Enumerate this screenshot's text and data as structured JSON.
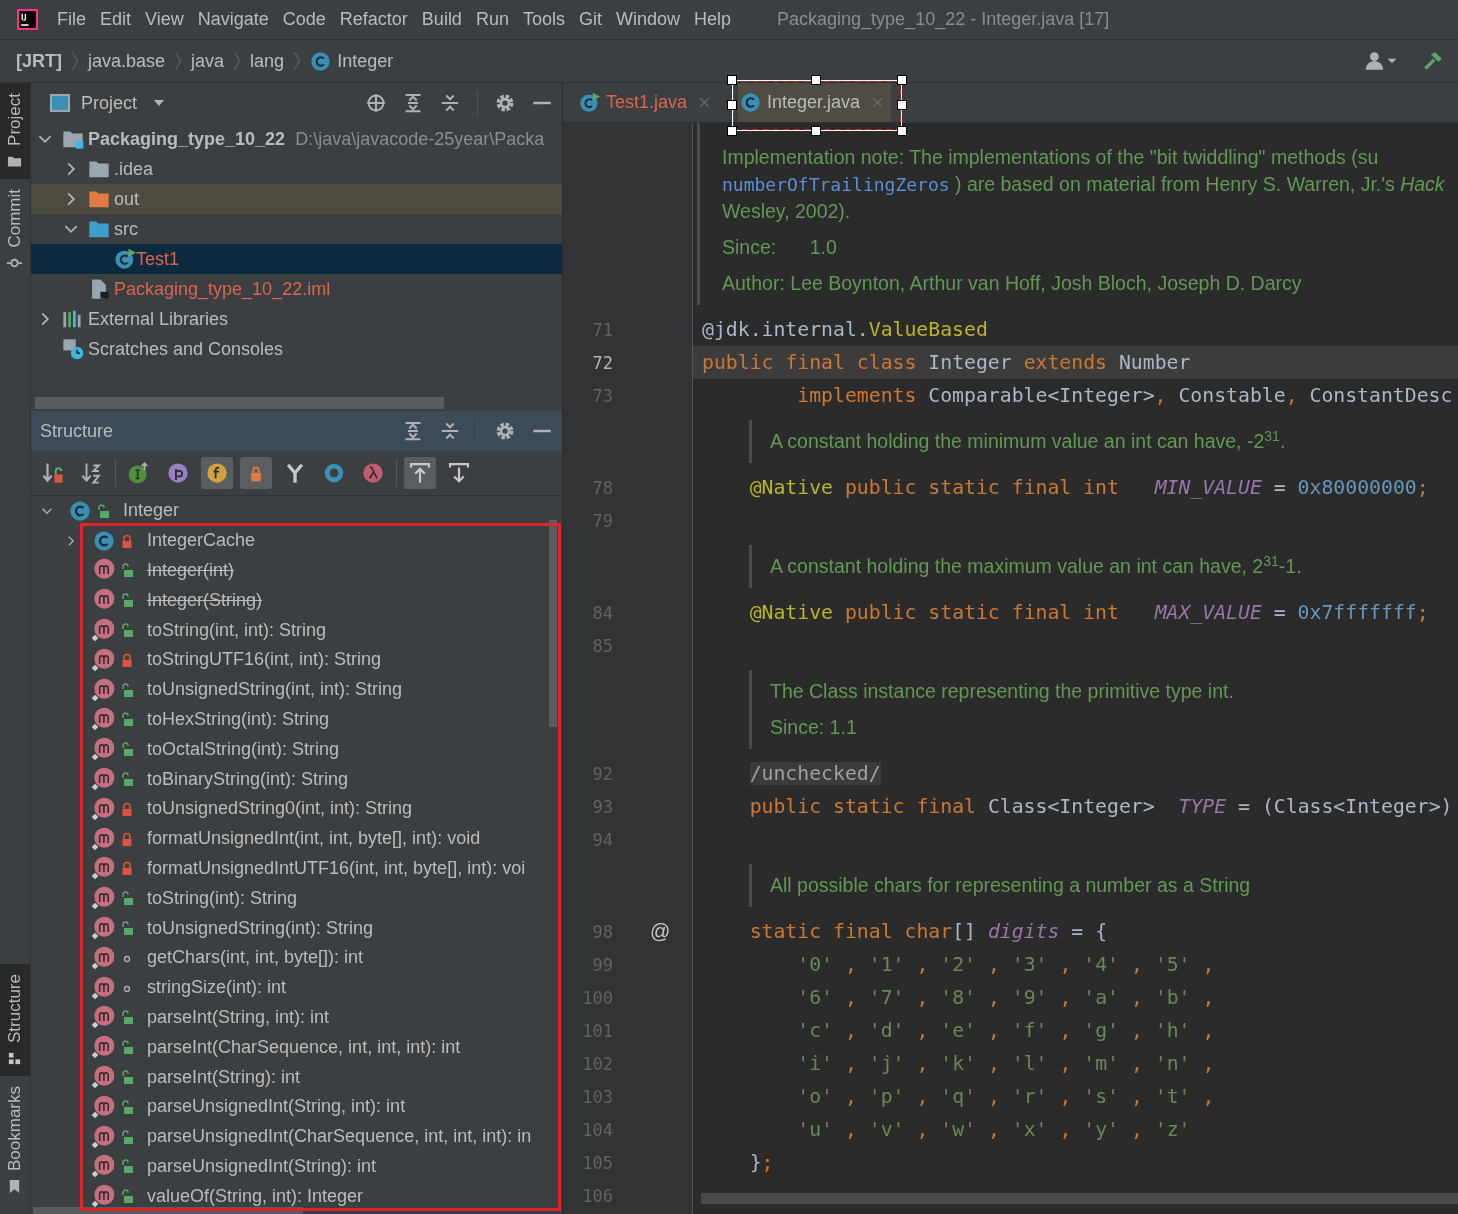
{
  "window": {
    "title": "Packaging_type_10_22 - Integer.java [17]"
  },
  "menu": [
    "File",
    "Edit",
    "View",
    "Navigate",
    "Code",
    "Refactor",
    "Build",
    "Run",
    "Tools",
    "Git",
    "Window",
    "Help"
  ],
  "breadcrumb": [
    {
      "label": "[JRT]",
      "kind": "root"
    },
    {
      "label": "java.base",
      "kind": "plain"
    },
    {
      "label": "java",
      "kind": "plain"
    },
    {
      "label": "lang",
      "kind": "plain"
    },
    {
      "label": "Integer",
      "kind": "class"
    }
  ],
  "tool_stripe": {
    "top": [
      {
        "label": "Project",
        "kind": "project",
        "selected": true
      },
      {
        "label": "Commit",
        "kind": "commit",
        "selected": false
      }
    ],
    "bottom": [
      {
        "label": "Structure",
        "kind": "structure",
        "selected": true
      },
      {
        "label": "Bookmarks",
        "kind": "bookmarks",
        "selected": false
      }
    ]
  },
  "project_panel": {
    "title": "Project",
    "tree": [
      {
        "label": "Packaging_type_10_22",
        "path": "D:\\java\\javacode-25year\\Packa",
        "kind": "module",
        "expanded": true,
        "selected": false,
        "untracked": false,
        "children": [
          {
            "label": ".idea",
            "kind": "folder",
            "expanded": false,
            "selected": false,
            "untracked": false
          },
          {
            "label": "out",
            "kind": "excluded-folder",
            "expanded": false,
            "selected": false,
            "untracked": false
          },
          {
            "label": "src",
            "kind": "source-folder",
            "expanded": true,
            "selected": false,
            "untracked": false,
            "children": [
              {
                "label": "Test1",
                "kind": "runnable-class",
                "selected": true,
                "untracked": true
              }
            ]
          },
          {
            "label": "Packaging_type_10_22.iml",
            "kind": "module-file",
            "selected": false,
            "untracked": true
          }
        ]
      },
      {
        "label": "External Libraries",
        "kind": "libraries",
        "expanded": false,
        "selected": false,
        "untracked": false
      },
      {
        "label": "Scratches and Consoles",
        "kind": "scratches",
        "selected": false,
        "untracked": false
      }
    ]
  },
  "structure_panel": {
    "title": "Structure",
    "toolbar": [
      [
        {
          "kind": "sort-visibility",
          "on": false
        },
        {
          "kind": "sort-alpha",
          "on": false
        }
      ],
      [
        {
          "kind": "inherited",
          "on": false
        },
        {
          "kind": "properties",
          "on": false
        },
        {
          "kind": "fields",
          "on": true
        },
        {
          "kind": "non-public",
          "on": true
        },
        {
          "kind": "fork",
          "on": false
        },
        {
          "kind": "ring",
          "on": false
        },
        {
          "kind": "lambda",
          "on": false
        }
      ],
      [
        {
          "kind": "autoscroll-to",
          "on": true
        },
        {
          "kind": "autoscroll-from",
          "on": false
        }
      ]
    ],
    "tree": [
      {
        "label": "Integer",
        "kind": "public-class",
        "expanded": true,
        "deprecated": false,
        "children": [
          {
            "label": "IntegerCache",
            "kind": "private-class",
            "expanded": false,
            "deprecated": false
          },
          {
            "label": "Integer(int)",
            "kind": "public-method",
            "deprecated": true,
            "static": false
          },
          {
            "label": "Integer(String)",
            "kind": "public-method",
            "deprecated": true,
            "static": false
          },
          {
            "label": "toString(int, int): String",
            "kind": "public-method",
            "deprecated": false,
            "static": true
          },
          {
            "label": "toStringUTF16(int, int): String",
            "kind": "private-method",
            "deprecated": false,
            "static": true
          },
          {
            "label": "toUnsignedString(int, int): String",
            "kind": "public-method",
            "deprecated": false,
            "static": true
          },
          {
            "label": "toHexString(int): String",
            "kind": "public-method",
            "deprecated": false,
            "static": true
          },
          {
            "label": "toOctalString(int): String",
            "kind": "public-method",
            "deprecated": false,
            "static": true
          },
          {
            "label": "toBinaryString(int): String",
            "kind": "public-method",
            "deprecated": false,
            "static": true
          },
          {
            "label": "toUnsignedString0(int, int): String",
            "kind": "private-method",
            "deprecated": false,
            "static": true
          },
          {
            "label": "formatUnsignedInt(int, int, byte[], int): void",
            "kind": "private-method",
            "deprecated": false,
            "static": true
          },
          {
            "label": "formatUnsignedIntUTF16(int, int, byte[], int): voi",
            "kind": "private-method",
            "deprecated": false,
            "static": true
          },
          {
            "label": "toString(int): String",
            "kind": "public-method",
            "deprecated": false,
            "static": true
          },
          {
            "label": "toUnsignedString(int): String",
            "kind": "public-method",
            "deprecated": false,
            "static": true
          },
          {
            "label": "getChars(int, int, byte[]): int",
            "kind": "package-method",
            "deprecated": false,
            "static": true
          },
          {
            "label": "stringSize(int): int",
            "kind": "package-method",
            "deprecated": false,
            "static": true
          },
          {
            "label": "parseInt(String, int): int",
            "kind": "public-method",
            "deprecated": false,
            "static": true
          },
          {
            "label": "parseInt(CharSequence, int, int, int): int",
            "kind": "public-method",
            "deprecated": false,
            "static": true
          },
          {
            "label": "parseInt(String): int",
            "kind": "public-method",
            "deprecated": false,
            "static": true
          },
          {
            "label": "parseUnsignedInt(String, int): int",
            "kind": "public-method",
            "deprecated": false,
            "static": true
          },
          {
            "label": "parseUnsignedInt(CharSequence, int, int, int): in",
            "kind": "public-method",
            "deprecated": false,
            "static": true
          },
          {
            "label": "parseUnsignedInt(String): int",
            "kind": "public-method",
            "deprecated": false,
            "static": true
          },
          {
            "label": "valueOf(String, int): Integer",
            "kind": "public-method",
            "deprecated": false,
            "static": true
          }
        ]
      }
    ]
  },
  "editor": {
    "tabs": [
      {
        "label": "Test1.java",
        "kind": "runnable-class",
        "selected": false,
        "untracked": true
      },
      {
        "label": "Integer.java",
        "kind": "class",
        "selected": true,
        "untracked": false
      }
    ],
    "lines": [
      {
        "kind": "doc",
        "inside_class": false,
        "paragraphs": [
          [
            {
              "text": "Implementation note: The implementations of the \"bit twiddling\" methods (su"
            },
            {
              "link": "numberOfTrailingZeros",
              "text": ") are based on material from Henry S. Warren, Jr.'s *Hack*"
            },
            {
              "text": "Wesley, 2002)."
            }
          ],
          [
            {
              "label": "Since:",
              "text": "1.0"
            }
          ],
          [
            {
              "text": "Author: Lee Boynton, Arthur van Hoff, Josh Bloch, Joseph D. Darcy"
            }
          ]
        ]
      },
      {
        "kind": "code",
        "number": "71",
        "current": false,
        "text": "@jdk.internal.ValueBased"
      },
      {
        "kind": "code",
        "number": "72",
        "current": true,
        "text": "public final class Integer extends Number"
      },
      {
        "kind": "code",
        "number": "73",
        "current": false,
        "text": "        implements Comparable<Integer>, Constable, ConstantDesc"
      },
      {
        "kind": "doc",
        "inside_class": true,
        "paragraphs": [
          [
            {
              "text": "A constant holding the minimum value an int can have, -2$^{31}$."
            }
          ]
        ]
      },
      {
        "kind": "code",
        "number": "78",
        "current": false,
        "text": "    @Native public static final int   MIN_VALUE = 0x80000000;"
      },
      {
        "kind": "code",
        "number": "79",
        "current": false
      },
      {
        "kind": "doc",
        "inside_class": true,
        "paragraphs": [
          [
            {
              "text": "A constant holding the maximum value an int can have, 2$^{31}$-1."
            }
          ]
        ]
      },
      {
        "kind": "code",
        "number": "84",
        "current": false,
        "text": "    @Native public static final int   MAX_VALUE = 0x7fffffff;"
      },
      {
        "kind": "code",
        "number": "85",
        "current": false
      },
      {
        "kind": "doc",
        "inside_class": true,
        "paragraphs": [
          [
            {
              "text": "The Class instance representing the primitive type int."
            }
          ],
          [
            {
              "text": "Since: 1.1"
            }
          ]
        ]
      },
      {
        "kind": "code",
        "number": "92",
        "current": false,
        "text": "    /unchecked/"
      },
      {
        "kind": "code",
        "number": "93",
        "current": false,
        "text": "    public static final Class<Integer>  TYPE = (Class<Integer>)"
      },
      {
        "kind": "code",
        "number": "94",
        "current": false
      },
      {
        "kind": "doc",
        "inside_class": true,
        "paragraphs": [
          [
            {
              "text": "All possible chars for representing a number as a String"
            }
          ]
        ]
      },
      {
        "kind": "code",
        "number": "98",
        "current": false,
        "marker": "@",
        "text": "    static final char[] digits = {"
      },
      {
        "kind": "code",
        "number": "99",
        "current": false,
        "text": "        '0' , '1' , '2' , '3' , '4' , '5' ,"
      },
      {
        "kind": "code",
        "number": "100",
        "current": false,
        "text": "        '6' , '7' , '8' , '9' , 'a' , 'b' ,"
      },
      {
        "kind": "code",
        "number": "101",
        "current": false,
        "text": "        'c' , 'd' , 'e' , 'f' , 'g' , 'h' ,"
      },
      {
        "kind": "code",
        "number": "102",
        "current": false,
        "text": "        'i' , 'j' , 'k' , 'l' , 'm' , 'n' ,"
      },
      {
        "kind": "code",
        "number": "103",
        "current": false,
        "text": "        'o' , 'p' , 'q' , 'r' , 's' , 't' ,"
      },
      {
        "kind": "code",
        "number": "104",
        "current": false,
        "text": "        'u' , 'v' , 'w' , 'x' , 'y' , 'z'"
      },
      {
        "kind": "code",
        "number": "105",
        "current": false,
        "text": "    };"
      },
      {
        "kind": "code",
        "number": "106",
        "current": false
      }
    ]
  }
}
